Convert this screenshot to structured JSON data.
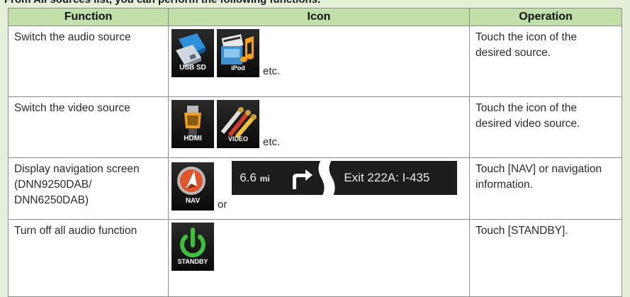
{
  "intro": "From All sources list, you can perform the following functions.",
  "headers": {
    "function": "Function",
    "icon": "Icon",
    "operation": "Operation"
  },
  "rows": [
    {
      "function": "Switch the audio source",
      "icons": [
        {
          "name": "usb-sd-icon",
          "caption": "USB SD"
        },
        {
          "name": "ipod-icon",
          "caption": "iPod"
        }
      ],
      "after": "etc.",
      "operation": "Touch the icon of the desired source."
    },
    {
      "function": "Switch the video source",
      "icons": [
        {
          "name": "hdmi-icon",
          "caption": "HDMI"
        },
        {
          "name": "video-icon",
          "caption": "VIDEO"
        }
      ],
      "after": "etc.",
      "operation": "Touch the icon of the desired video source."
    },
    {
      "function": "Display navigation screen (DNN9250DAB/ DNN6250DAB)",
      "icons": [
        {
          "name": "nav-icon",
          "caption": "NAV"
        }
      ],
      "after": "or",
      "nav_info": {
        "distance": "6.6",
        "unit": "mi",
        "exit": "Exit 222A: I-435"
      },
      "operation": "Touch [NAV] or navigation information."
    },
    {
      "function": "Turn off all audio function",
      "icons": [
        {
          "name": "standby-icon",
          "caption": "STANDBY"
        }
      ],
      "operation": "Touch [STANDBY]."
    }
  ],
  "colors": {
    "header_bg": "#c3dfa9",
    "page_bg": "#e4efd9",
    "power_green": "#3cc23a",
    "nav_orange": "#e2552a"
  }
}
